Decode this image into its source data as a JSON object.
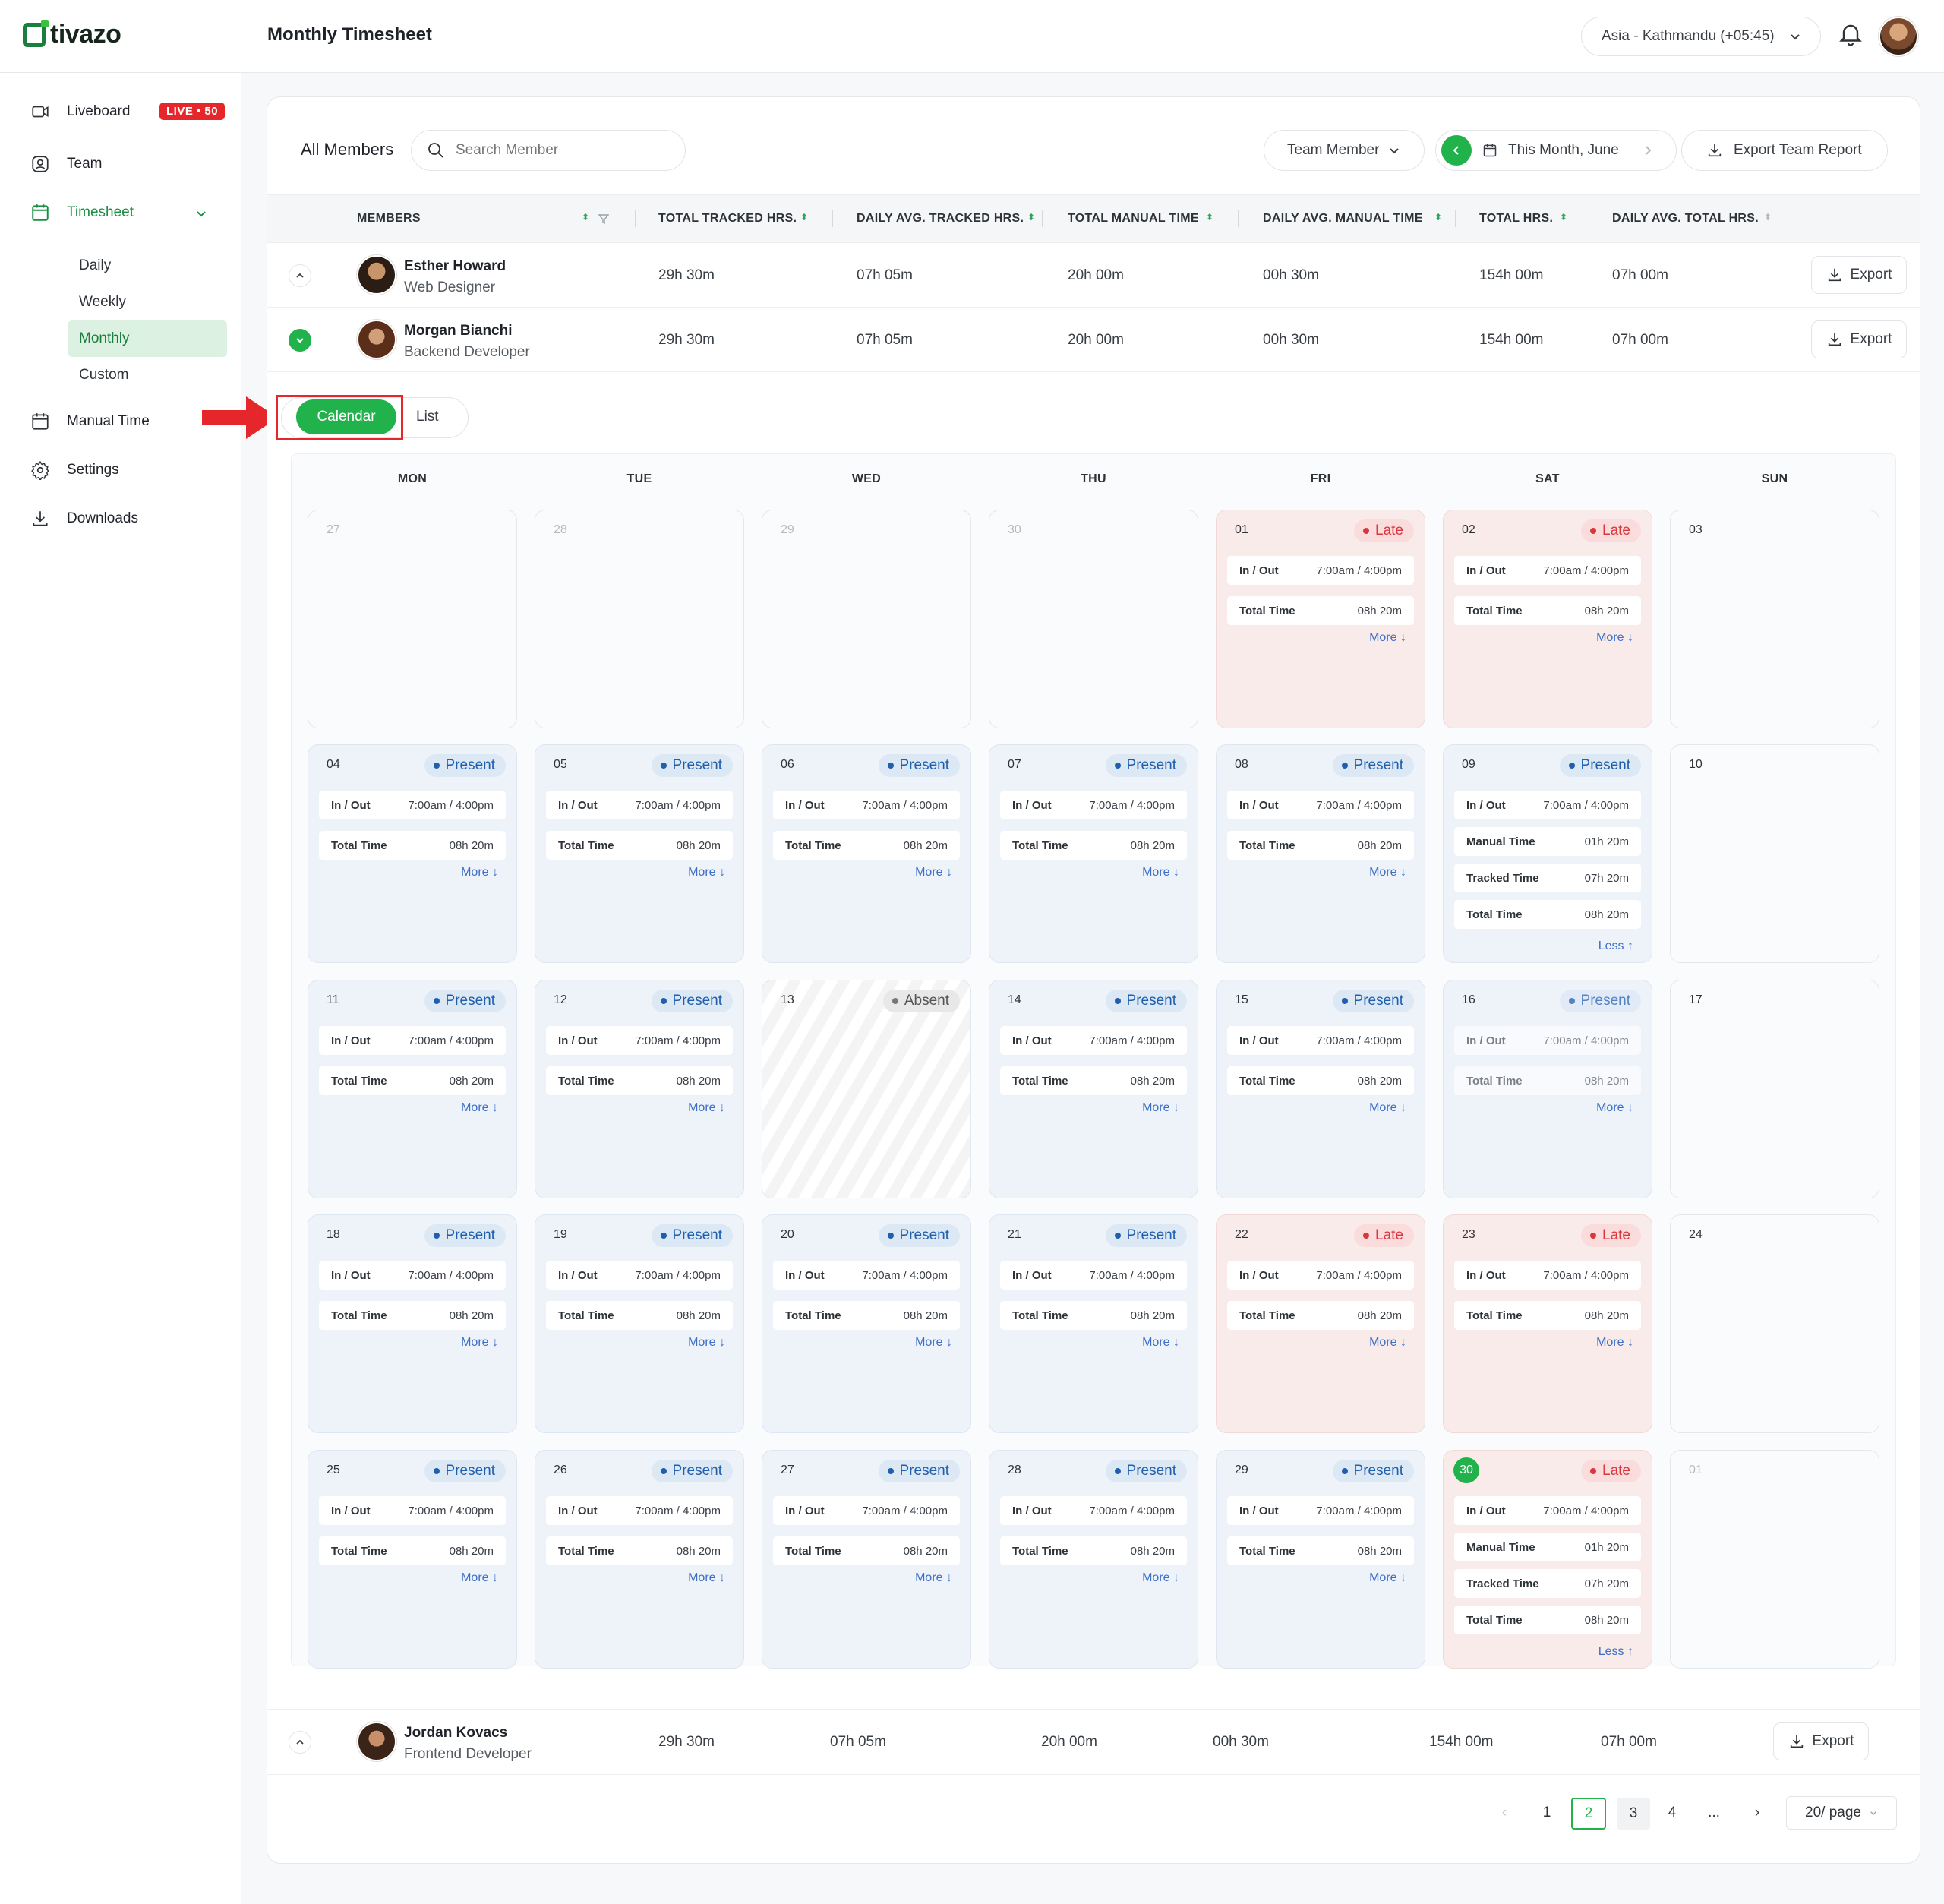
{
  "app": {
    "brand": "tivazo",
    "page_title": "Monthly Timesheet"
  },
  "header": {
    "timezone": "Asia - Kathmandu (+05:45)"
  },
  "sidebar": {
    "liveboard": "Liveboard",
    "live_badge": "LIVE • 50",
    "team": "Team",
    "timesheet": "Timesheet",
    "sub": [
      "Daily",
      "Weekly",
      "Monthly",
      "Custom"
    ],
    "manual_time": "Manual Time",
    "settings": "Settings",
    "downloads": "Downloads"
  },
  "toolbar": {
    "all_members": "All Members",
    "search_placeholder": "Search Member",
    "team_member": "Team Member",
    "period": "This Month, June",
    "export_team": "Export Team Report"
  },
  "table": {
    "columns": [
      "MEMBERS",
      "TOTAL TRACKED HRS.",
      "DAILY AVG. TRACKED HRS.",
      "TOTAL MANUAL TIME",
      "DAILY AVG.  MANUAL TIME",
      "TOTAL HRS.",
      "DAILY AVG. TOTAL HRS."
    ],
    "export_label": "Export",
    "rows": [
      {
        "name": "Esther Howard",
        "role": "Web Designer",
        "values": [
          "29h 30m",
          "07h 05m",
          "20h 00m",
          "00h 30m",
          "154h 00m",
          "07h 00m"
        ]
      },
      {
        "name": "Morgan Bianchi",
        "role": "Backend Developer",
        "values": [
          "29h 30m",
          "07h 05m",
          "20h 00m",
          "00h 30m",
          "154h 00m",
          "07h 00m"
        ]
      },
      {
        "name": "Jordan Kovacs",
        "role": "Frontend Developer",
        "values": [
          "29h 30m",
          "07h 05m",
          "20h 00m",
          "00h 30m",
          "154h 00m",
          "07h 00m"
        ]
      }
    ]
  },
  "view": {
    "calendar": "Calendar",
    "list": "List"
  },
  "calendar": {
    "weekdays": [
      "MON",
      "TUE",
      "WED",
      "THU",
      "FRI",
      "SAT",
      "SUN"
    ],
    "labels": {
      "in_out": "In / Out",
      "total_time": "Total Time",
      "manual_time": "Manual Time",
      "tracked_time": "Tracked Time",
      "more": "More ↓",
      "less": "Less ↑"
    },
    "in_out_value": "7:00am / 4:00pm",
    "total_value": "08h 20m",
    "manual_value": "01h 20m",
    "tracked_value": "07h 20m",
    "weeks": [
      [
        {
          "d": "27",
          "s": "",
          "muted": true
        },
        {
          "d": "28",
          "s": "",
          "muted": true
        },
        {
          "d": "29",
          "s": "",
          "muted": true
        },
        {
          "d": "30",
          "s": "",
          "muted": true
        },
        {
          "d": "01",
          "s": "Late"
        },
        {
          "d": "02",
          "s": "Late"
        },
        {
          "d": "03",
          "s": ""
        }
      ],
      [
        {
          "d": "04",
          "s": "Present"
        },
        {
          "d": "05",
          "s": "Present"
        },
        {
          "d": "06",
          "s": "Present"
        },
        {
          "d": "07",
          "s": "Present"
        },
        {
          "d": "08",
          "s": "Present"
        },
        {
          "d": "09",
          "s": "Present",
          "expanded": true
        },
        {
          "d": "10",
          "s": ""
        }
      ],
      [
        {
          "d": "11",
          "s": "Present"
        },
        {
          "d": "12",
          "s": "Present"
        },
        {
          "d": "13",
          "s": "Absent"
        },
        {
          "d": "14",
          "s": "Present"
        },
        {
          "d": "15",
          "s": "Present"
        },
        {
          "d": "16",
          "s": "Present",
          "faded": true
        },
        {
          "d": "17",
          "s": ""
        }
      ],
      [
        {
          "d": "18",
          "s": "Present"
        },
        {
          "d": "19",
          "s": "Present"
        },
        {
          "d": "20",
          "s": "Present"
        },
        {
          "d": "21",
          "s": "Present"
        },
        {
          "d": "22",
          "s": "Late"
        },
        {
          "d": "23",
          "s": "Late"
        },
        {
          "d": "24",
          "s": ""
        }
      ],
      [
        {
          "d": "25",
          "s": "Present"
        },
        {
          "d": "26",
          "s": "Present"
        },
        {
          "d": "27",
          "s": "Present"
        },
        {
          "d": "28",
          "s": "Present"
        },
        {
          "d": "29",
          "s": "Present"
        },
        {
          "d": "30",
          "s": "Late",
          "expanded": true,
          "today": true
        },
        {
          "d": "01",
          "s": "",
          "muted": true
        }
      ]
    ]
  },
  "pagination": {
    "pages": [
      "1",
      "2",
      "3",
      "4",
      "..."
    ],
    "current": "2",
    "page_size": "20/ page"
  },
  "colors": {
    "accent": "#22b24c",
    "present": "#1f5fae",
    "late": "#d9363e",
    "annotation": "#e5262b"
  }
}
